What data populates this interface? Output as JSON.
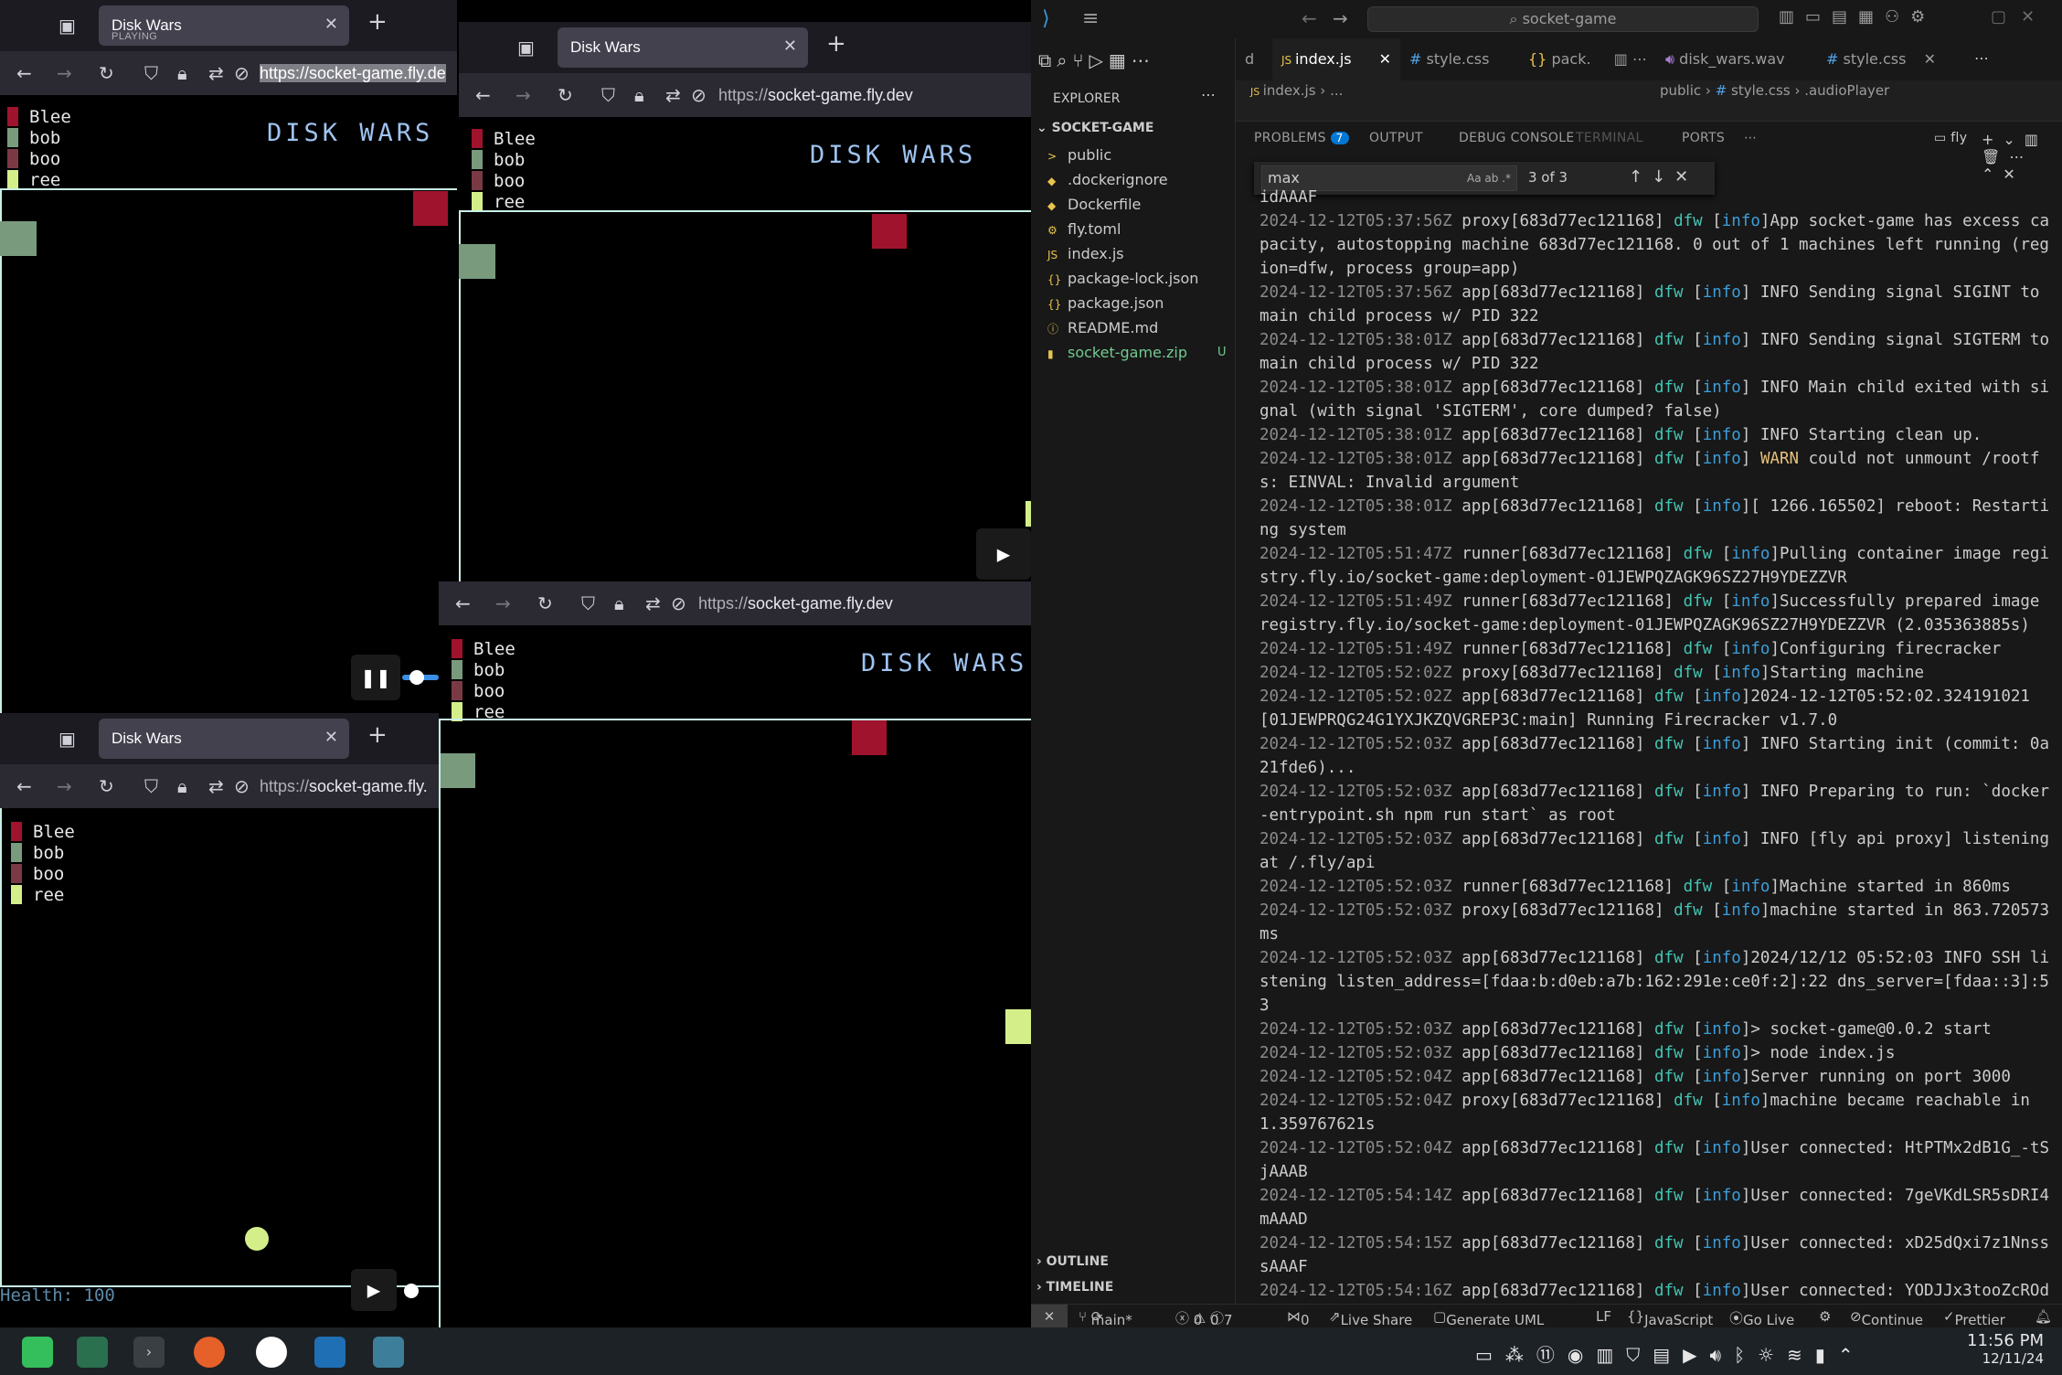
{
  "game": {
    "title": "DISK WARS",
    "players": [
      {
        "name": "Blee",
        "color": "#a0132d"
      },
      {
        "name": "bob",
        "color": "#7a9a7e"
      },
      {
        "name": "boo",
        "color": "#7a3a45"
      },
      {
        "name": "ree",
        "color": "#d4ef8a"
      }
    ],
    "health_label": "Health: 100"
  },
  "browsers": [
    {
      "tab_title": "Disk Wars",
      "tab_status": "PLAYING",
      "url_scheme": "https://",
      "url_host": "socket-game.fly.de"
    },
    {
      "tab_title": "Disk Wars",
      "url_scheme": "https://",
      "url_host": "socket-game.fly.dev"
    },
    {
      "url_scheme": "https://",
      "url_host": "socket-game.fly.dev"
    },
    {
      "tab_title": "Disk Wars",
      "url_scheme": "https://",
      "url_host": "socket-game.fly."
    }
  ],
  "vscode": {
    "search": "socket-game",
    "tabs": [
      "d",
      "index.js",
      "style.css",
      "pack.",
      "disk_wars.wav",
      "style.css"
    ],
    "breadcrumb_left": [
      "index.js",
      "..."
    ],
    "breadcrumb_right": [
      "public",
      "style.css",
      ".audioPlayer"
    ],
    "explorer_title": "EXPLORER",
    "project": "SOCKET-GAME",
    "files": [
      {
        "name": "public",
        "icon": ">",
        "color": "#cccccc"
      },
      {
        "name": ".dockerignore",
        "icon": "◆",
        "color": "#cccccc"
      },
      {
        "name": "Dockerfile",
        "icon": "◆",
        "color": "#cccccc"
      },
      {
        "name": "fly.toml",
        "icon": "⚙",
        "color": "#cccccc"
      },
      {
        "name": "index.js",
        "icon": "JS",
        "color": "#cccccc"
      },
      {
        "name": "package-lock.json",
        "icon": "{}",
        "color": "#cccccc"
      },
      {
        "name": "package.json",
        "icon": "{}",
        "color": "#cccccc"
      },
      {
        "name": "README.md",
        "icon": "ⓘ",
        "color": "#cccccc"
      },
      {
        "name": "socket-game.zip",
        "icon": "▮",
        "color": "#73c991",
        "badge": "U"
      }
    ],
    "outline": "OUTLINE",
    "timeline": "TIMELINE",
    "panel_tabs": {
      "problems": "PROBLEMS",
      "problems_count": "7",
      "output": "OUTPUT",
      "debug": "DEBUG CONSOLE",
      "terminal": "TERMINAL",
      "ports": "PORTS"
    },
    "terminal_name": "fly",
    "find": {
      "value": "max",
      "result": "3 of 3"
    },
    "terminal_lines": [
      {
        "t": "",
        "body": "idAAAF"
      },
      {
        "t": "2024-12-12T05:37:56Z",
        "src": "proxy[683d77ec121168]",
        "lvl": "info",
        "body": "App socket-game has excess capacity, autostopping machine 683d77ec121168. 0 out of 1 machines left running (region=dfw, process group=app)"
      },
      {
        "t": "2024-12-12T05:37:56Z",
        "src": "app[683d77ec121168]",
        "lvl": "info",
        "body": " INFO Sending signal SIGINT to main child process w/ PID 322"
      },
      {
        "t": "2024-12-12T05:38:01Z",
        "src": "app[683d77ec121168]",
        "lvl": "info",
        "body": " INFO Sending signal SIGTERM to main child process w/ PID 322"
      },
      {
        "t": "2024-12-12T05:38:01Z",
        "src": "app[683d77ec121168]",
        "lvl": "info",
        "body": " INFO Main child exited with signal (with signal 'SIGTERM', core dumped? false)"
      },
      {
        "t": "2024-12-12T05:38:01Z",
        "src": "app[683d77ec121168]",
        "lvl": "info",
        "body": " INFO Starting clean up."
      },
      {
        "t": "2024-12-12T05:38:01Z",
        "src": "app[683d77ec121168]",
        "lvl": "info",
        "warn": "WARN",
        "body": " could not unmount /rootfs: EINVAL: Invalid argument"
      },
      {
        "t": "2024-12-12T05:38:01Z",
        "src": "app[683d77ec121168]",
        "lvl": "info",
        "body": "[ 1266.165502] reboot: Restarting system"
      },
      {
        "t": "2024-12-12T05:51:47Z",
        "src": "runner[683d77ec121168]",
        "lvl": "info",
        "body": "Pulling container image registry.fly.io/socket-game:deployment-01JEWPQZAGK96SZ27H9YDEZZVR"
      },
      {
        "t": "2024-12-12T05:51:49Z",
        "src": "runner[683d77ec121168]",
        "lvl": "info",
        "body": "Successfully prepared image registry.fly.io/socket-game:deployment-01JEWPQZAGK96SZ27H9YDEZZVR (2.035363885s)"
      },
      {
        "t": "2024-12-12T05:51:49Z",
        "src": "runner[683d77ec121168]",
        "lvl": "info",
        "body": "Configuring firecracker"
      },
      {
        "t": "2024-12-12T05:52:02Z",
        "src": "proxy[683d77ec121168]",
        "lvl": "info",
        "body": "Starting machine"
      },
      {
        "t": "2024-12-12T05:52:02Z",
        "src": "app[683d77ec121168]",
        "lvl": "info",
        "body": "2024-12-12T05:52:02.324191021 [01JEWPRQG24G1YXJKZQVGREP3C:main] Running Firecracker v1.7.0"
      },
      {
        "t": "2024-12-12T05:52:03Z",
        "src": "app[683d77ec121168]",
        "lvl": "info",
        "body": " INFO Starting init (commit: 0a21fde6)..."
      },
      {
        "t": "2024-12-12T05:52:03Z",
        "src": "app[683d77ec121168]",
        "lvl": "info",
        "body": " INFO Preparing to run: `docker-entrypoint.sh npm run start` as root"
      },
      {
        "t": "2024-12-12T05:52:03Z",
        "src": "app[683d77ec121168]",
        "lvl": "info",
        "body": " INFO [fly api proxy] listening at /.fly/api"
      },
      {
        "t": "2024-12-12T05:52:03Z",
        "src": "runner[683d77ec121168]",
        "lvl": "info",
        "body": "Machine started in 860ms"
      },
      {
        "t": "2024-12-12T05:52:03Z",
        "src": "proxy[683d77ec121168]",
        "lvl": "info",
        "body": "machine started in 863.720573ms"
      },
      {
        "t": "2024-12-12T05:52:03Z",
        "src": "app[683d77ec121168]",
        "lvl": "info",
        "body": "2024/12/12 05:52:03 INFO SSH listening listen_address=[fdaa:b:d0eb:a7b:162:291e:ce0f:2]:22 dns_server=[fdaa::3]:53"
      },
      {
        "t": "2024-12-12T05:52:03Z",
        "src": "app[683d77ec121168]",
        "lvl": "info",
        "body": "> socket-game@0.0.2 start"
      },
      {
        "t": "2024-12-12T05:52:03Z",
        "src": "app[683d77ec121168]",
        "lvl": "info",
        "body": "> node index.js"
      },
      {
        "t": "2024-12-12T05:52:04Z",
        "src": "app[683d77ec121168]",
        "lvl": "info",
        "body": "Server running on port 3000"
      },
      {
        "t": "2024-12-12T05:52:04Z",
        "src": "proxy[683d77ec121168]",
        "lvl": "info",
        "body": "machine became reachable in 1.359767621s"
      },
      {
        "t": "2024-12-12T05:52:04Z",
        "src": "app[683d77ec121168]",
        "lvl": "info",
        "body": "User connected: HtPTMx2dB1G_-tSjAAAB"
      },
      {
        "t": "2024-12-12T05:54:14Z",
        "src": "app[683d77ec121168]",
        "lvl": "info",
        "body": "User connected: 7geVKdLSR5sDRI4mAAAD"
      },
      {
        "t": "2024-12-12T05:54:15Z",
        "src": "app[683d77ec121168]",
        "lvl": "info",
        "body": "User connected: xD25dQxi7z1NnsssAAAF"
      },
      {
        "t": "2024-12-12T05:54:16Z",
        "src": "app[683d77ec121168]",
        "lvl": "info",
        "body": "User connected: YODJJx3tooZcROdPAAAH"
      }
    ],
    "status": {
      "branch": "main*",
      "errors": "0",
      "warnings": "0",
      "info": "7",
      "ports": "0",
      "live_share": "Live Share",
      "uml": "Generate UML",
      "eol": "LF",
      "lang": "JavaScript",
      "golive": "Go Live",
      "cont": "Continue",
      "prettier": "Prettier"
    }
  },
  "taskbar": {
    "time": "11:56 PM",
    "date": "12/11/24"
  }
}
